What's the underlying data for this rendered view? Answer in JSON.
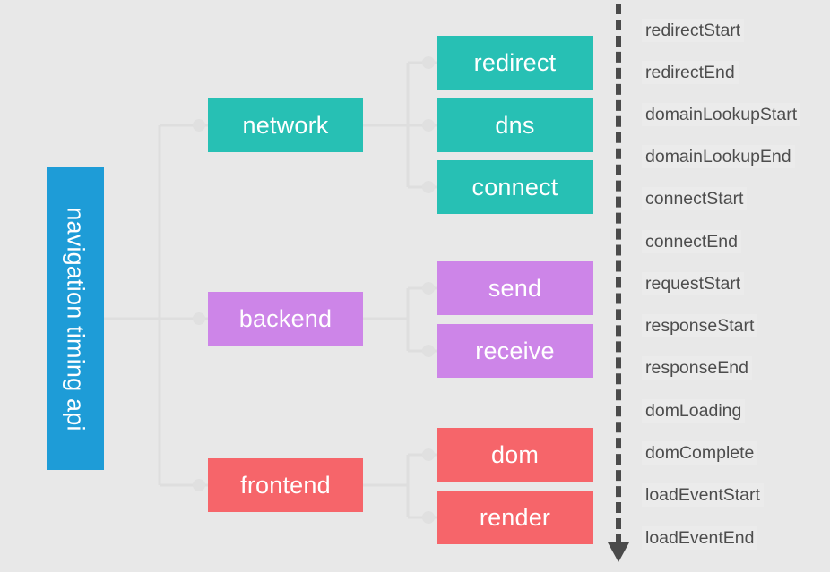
{
  "diagram": {
    "title": "navigation timing api",
    "background_color": "#e8e8e8",
    "root": {
      "label": "navigation timing api",
      "color": "#1e9cd7",
      "orientation": "vertical-rotated"
    },
    "groups": [
      {
        "label": "network",
        "color": "#27c0b4",
        "children": [
          {
            "label": "redirect",
            "color": "#27c0b4"
          },
          {
            "label": "dns",
            "color": "#27c0b4"
          },
          {
            "label": "connect",
            "color": "#27c0b4"
          }
        ]
      },
      {
        "label": "backend",
        "color": "#cd85e8",
        "children": [
          {
            "label": "send",
            "color": "#cd85e8"
          },
          {
            "label": "receive",
            "color": "#cd85e8"
          }
        ]
      },
      {
        "label": "frontend",
        "color": "#f6656a",
        "children": [
          {
            "label": "dom",
            "color": "#f6656a"
          },
          {
            "label": "render",
            "color": "#f6656a"
          }
        ]
      }
    ],
    "timeline": {
      "line_color": "#4a4a4a",
      "line_style": "dashed",
      "arrow_direction": "down",
      "events": [
        "redirectStart",
        "redirectEnd",
        "domainLookupStart",
        "domainLookupEnd",
        "connectStart",
        "connectEnd",
        "requestStart",
        "responseStart",
        "responseEnd",
        "domLoading",
        "domComplete",
        "loadEventStart",
        "loadEventEnd"
      ]
    }
  }
}
